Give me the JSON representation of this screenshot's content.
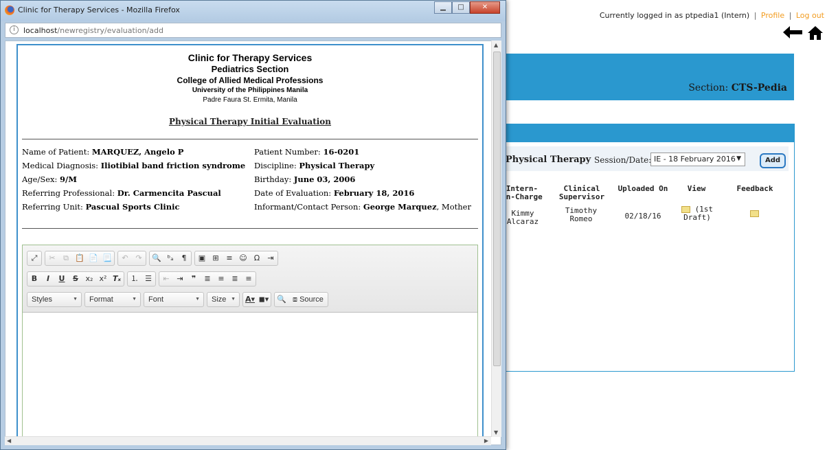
{
  "bg": {
    "login_text": "Currently logged in as ptpedia1 (Intern)",
    "sep": "|",
    "profile": "Profile",
    "logout": "Log out",
    "section_label": "Section: ",
    "section_value": "CTS-Pedia",
    "pt_title": "Physical Therapy",
    "session_label": "Session/Date:",
    "session_value": "IE - 18 February 2016",
    "add_label": "Add",
    "table": {
      "headers": [
        "Intern-\nin-Charge",
        "Clinical\nSupervisor",
        "Uploaded On",
        "View",
        "Feedback"
      ],
      "row": {
        "intern": "Kimmy\nAlcaraz",
        "supervisor": "Timothy\nRomeo",
        "uploaded": "02/18/16",
        "view_note": "(1st\nDraft)"
      }
    }
  },
  "window": {
    "title": "Clinic for Therapy Services - Mozilla Firefox",
    "url_host": "localhost",
    "url_path": "/newregistry/evaluation/add"
  },
  "doc": {
    "clinic": "Clinic for Therapy Services",
    "section": "Pediatrics Section",
    "college": "College of Allied Medical Professions",
    "university": "University of the Philippines Manila",
    "address": "Padre Faura St. Ermita, Manila",
    "title": "Physical Therapy Initial Evaluation",
    "fields": {
      "patient_label": "Name of Patient: ",
      "patient_value": "MARQUEZ, Angelo P",
      "diagnosis_label": "Medical Diagnosis: ",
      "diagnosis_value": "Iliotibial band friction syndrome",
      "agesex_label": "Age/Sex: ",
      "agesex_value": "9/M",
      "referring_label": "Referring Professional: ",
      "referring_value": "Dr. Carmencita Pascual",
      "unit_label": "Referring Unit: ",
      "unit_value": "Pascual Sports Clinic",
      "patientno_label": "Patient Number: ",
      "patientno_value": "16-0201",
      "discipline_label": "Discipline: ",
      "discipline_value": "Physical Therapy",
      "birthday_label": "Birthday: ",
      "birthday_value": "June 03, 2006",
      "eval_label": "Date of Evaluation: ",
      "eval_value": "February 18, 2016",
      "informant_label": "Informant/Contact Person: ",
      "informant_value": "George Marquez",
      "informant_suffix": ", Mother"
    }
  },
  "editor": {
    "styles": "Styles",
    "format": "Format",
    "font": "Font",
    "size": "Size",
    "source": "Source"
  },
  "colors": {
    "accent_blue": "#2a98cf",
    "link_orange": "#f29c20",
    "editor_border": "#9fc08f"
  }
}
